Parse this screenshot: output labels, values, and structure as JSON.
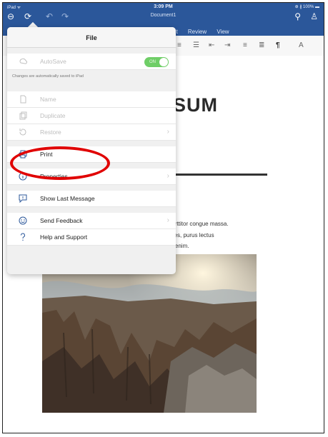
{
  "status_bar": {
    "left": "iPad ᯤ",
    "time": "3:09 PM",
    "right": "⊕ ∦ 100% ▬"
  },
  "document_title": "Document1",
  "ribbon_tabs": [
    "ut",
    "Review",
    "View"
  ],
  "menu": {
    "title": "File",
    "autosave_label": "AutoSave",
    "autosave_toggle": "ON",
    "autosave_note": "Changes are automatically saved to iPad",
    "items_disabled": [
      "Name",
      "Duplicate",
      "Restore"
    ],
    "print_label": "Print",
    "properties_label": "Properties",
    "show_last_message_label": "Show Last Message",
    "send_feedback_label": "Send Feedback",
    "help_label": "Help and Support"
  },
  "document": {
    "heading_fragment": "SUM",
    "body_lines": [
      "porttitor congue massa.",
      "icies, purus lectus",
      "et enim."
    ]
  },
  "colors": {
    "accent": "#2b579a",
    "toggle_on": "#6fce67",
    "annotation": "#e00000"
  }
}
